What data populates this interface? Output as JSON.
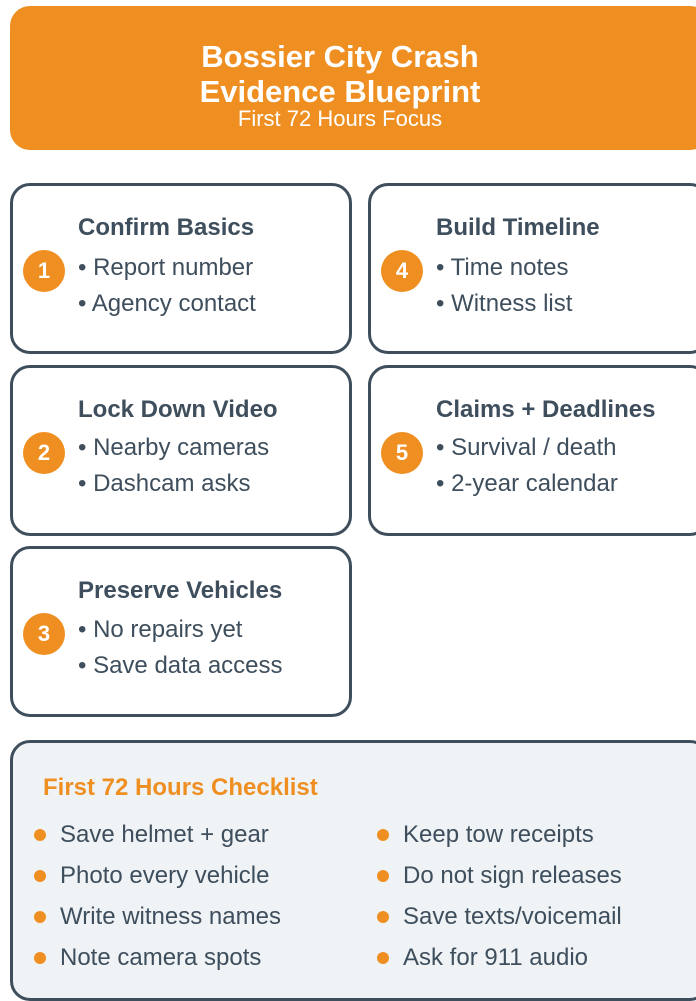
{
  "header": {
    "title_line1": "Bossier City Crash",
    "title_line2": "Evidence Blueprint",
    "subtitle": "First 72 Hours Focus"
  },
  "steps": [
    {
      "number": "1",
      "title": "Confirm Basics",
      "items": [
        "• Report number",
        "• Agency contact"
      ]
    },
    {
      "number": "2",
      "title": "Lock Down Video",
      "items": [
        "• Nearby cameras",
        "• Dashcam asks"
      ]
    },
    {
      "number": "3",
      "title": "Preserve Vehicles",
      "items": [
        "• No repairs yet",
        "• Save data access"
      ]
    },
    {
      "number": "4",
      "title": "Build Timeline",
      "items": [
        "• Time notes",
        "• Witness list"
      ]
    },
    {
      "number": "5",
      "title": "Claims + Deadlines",
      "items": [
        "• Survival / death",
        "• 2-year calendar"
      ]
    }
  ],
  "checklist": {
    "title": "First 72 Hours Checklist",
    "left": [
      "Save helmet + gear",
      "Photo every vehicle",
      "Write witness names",
      "Note camera spots"
    ],
    "right": [
      "Keep tow receipts",
      "Do not sign releases",
      "Save texts/voicemail",
      "Ask for 911 audio"
    ]
  },
  "colors": {
    "accent": "#ef8f22",
    "text": "#3e4e5c",
    "panel": "#eff3f6"
  }
}
